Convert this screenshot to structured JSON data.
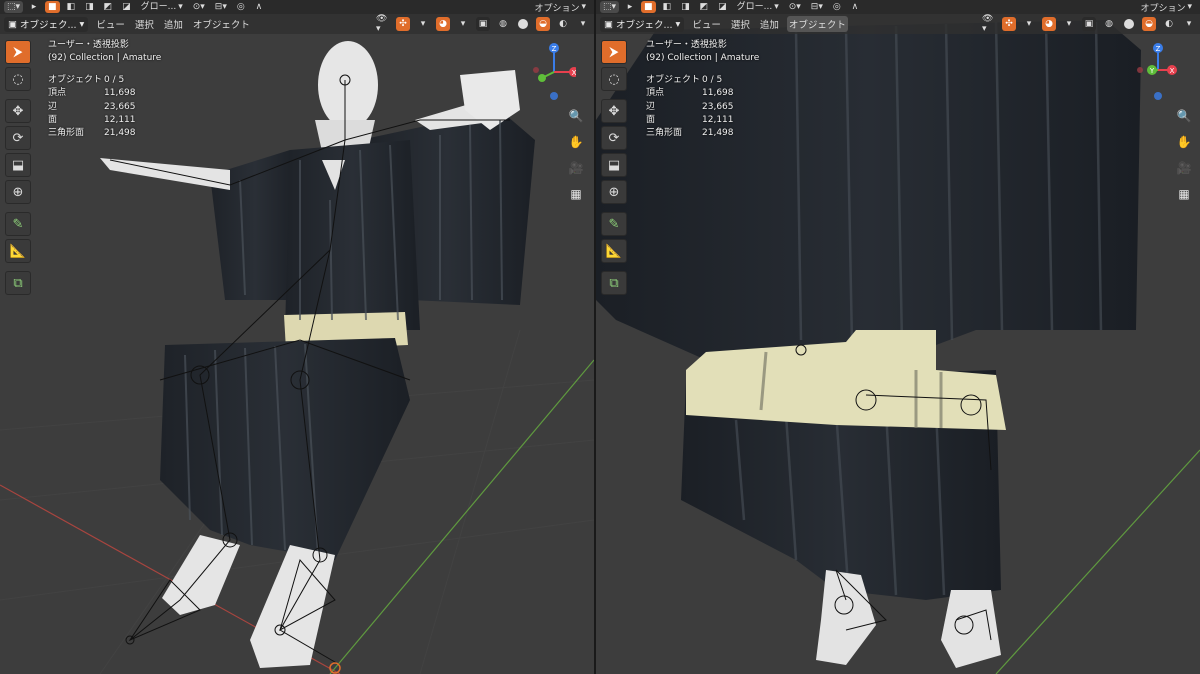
{
  "left_viewport": {
    "header": {
      "tool_settings": {
        "transform_orientation": "グロー...",
        "options_label": "オプション"
      },
      "mode": "オブジェク...",
      "menus": [
        "ビュー",
        "選択",
        "追加",
        "オブジェクト"
      ]
    },
    "overlay": {
      "view_name": "ユーザー・透視投影",
      "collection": "(92) Collection | Amature",
      "stats": [
        {
          "label": "オブジェクト",
          "value": "0 / 5"
        },
        {
          "label": "頂点",
          "value": "11,698"
        },
        {
          "label": "辺",
          "value": "23,665"
        },
        {
          "label": "面",
          "value": "12,111"
        },
        {
          "label": "三角形面",
          "value": "21,498"
        }
      ]
    }
  },
  "right_viewport": {
    "header": {
      "tool_settings": {
        "transform_orientation": "グロー...",
        "options_label": "オプション"
      },
      "mode": "オブジェク...",
      "menus": [
        "ビュー",
        "選択",
        "追加",
        "オブジェクト"
      ]
    },
    "overlay": {
      "view_name": "ユーザー・透視投影",
      "collection": "(92) Collection | Amature",
      "stats": [
        {
          "label": "オブジェクト",
          "value": "0 / 5"
        },
        {
          "label": "頂点",
          "value": "11,698"
        },
        {
          "label": "辺",
          "value": "23,665"
        },
        {
          "label": "面",
          "value": "12,111"
        },
        {
          "label": "三角形面",
          "value": "21,498"
        }
      ]
    }
  },
  "gizmo": {
    "x": "X",
    "y": "Y",
    "z": "Z"
  },
  "colors": {
    "accent": "#e06d2b",
    "axis_x": "#e8404e",
    "axis_y": "#5fbe3a",
    "axis_z": "#3a7de8",
    "viewport_bg": "#3d3d3d"
  }
}
